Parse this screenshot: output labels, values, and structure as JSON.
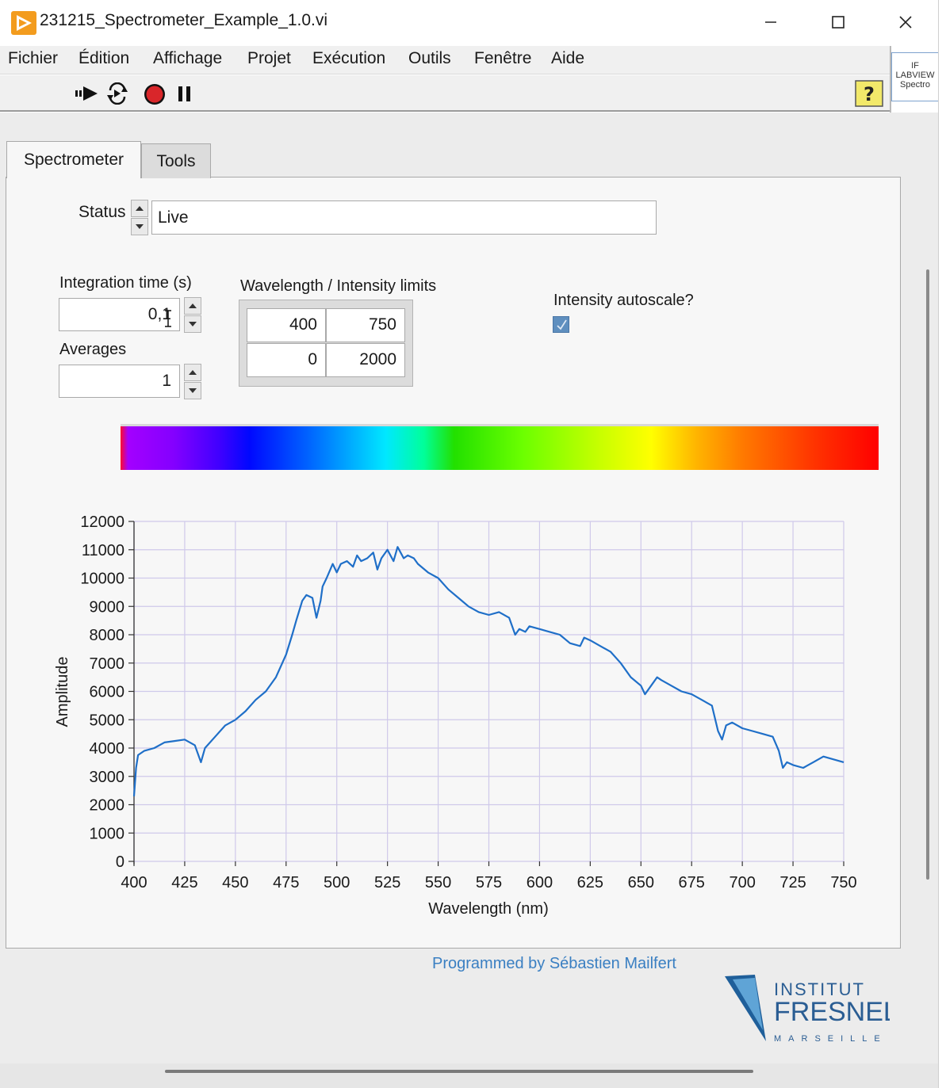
{
  "window": {
    "title": "231215_Spectrometer_Example_1.0.vi",
    "controls": {
      "minimize": "minimize-icon",
      "maximize": "maximize-icon",
      "close": "close-icon"
    }
  },
  "menu": {
    "items": [
      "Fichier",
      "Édition",
      "Affichage",
      "Projet",
      "Exécution",
      "Outils",
      "Fenêtre",
      "Aide"
    ]
  },
  "toolbar": {
    "icons": [
      "run-arrow-icon",
      "run-continuously-icon",
      "abort-stop-icon",
      "pause-icon",
      "context-help-icon"
    ],
    "connector_pane_text": [
      "IF",
      "LABVIEW",
      "Spectro"
    ]
  },
  "tabs": [
    {
      "label": "Spectrometer",
      "active": true
    },
    {
      "label": "Tools",
      "active": false
    }
  ],
  "status": {
    "label": "Status",
    "value": "Live"
  },
  "integration": {
    "label": "Integration time (s)",
    "value": "0,1"
  },
  "averages": {
    "label": "Averages",
    "value": "1"
  },
  "limits": {
    "label": "Wavelength / Intensity limits",
    "wavelength_min": "400",
    "wavelength_max": "750",
    "intensity_min": "0",
    "intensity_max": "2000"
  },
  "autoscale": {
    "label": "Intensity autoscale?",
    "checked": true
  },
  "chart_data": {
    "type": "line",
    "title": "",
    "xlabel": "Wavelength (nm)",
    "ylabel": "Amplitude",
    "xlim": [
      400,
      750
    ],
    "ylim": [
      0,
      12000
    ],
    "x_ticks": [
      400,
      425,
      450,
      475,
      500,
      525,
      550,
      575,
      600,
      625,
      650,
      675,
      700,
      725,
      750
    ],
    "y_ticks": [
      0,
      1000,
      2000,
      3000,
      4000,
      5000,
      6000,
      7000,
      8000,
      9000,
      10000,
      11000,
      12000
    ],
    "grid": true,
    "line_color": "#1f6fc8",
    "series": [
      {
        "x": [
          400,
          401,
          402,
          405,
          410,
          415,
          420,
          425,
          430,
          433,
          435,
          440,
          445,
          450,
          455,
          460,
          465,
          470,
          475,
          478,
          480,
          483,
          485,
          488,
          490,
          492,
          493,
          495,
          498,
          500,
          502,
          505,
          508,
          510,
          512,
          515,
          518,
          520,
          522,
          525,
          528,
          530,
          533,
          535,
          538,
          540,
          545,
          550,
          555,
          560,
          565,
          570,
          575,
          580,
          585,
          588,
          590,
          593,
          595,
          600,
          605,
          610,
          615,
          620,
          622,
          625,
          630,
          635,
          640,
          645,
          650,
          652,
          655,
          658,
          660,
          665,
          670,
          675,
          680,
          685,
          688,
          690,
          692,
          695,
          700,
          705,
          710,
          715,
          718,
          720,
          722,
          725,
          730,
          735,
          740,
          745,
          750
        ],
        "y": [
          2300,
          3300,
          3750,
          3900,
          4000,
          4200,
          4250,
          4300,
          4100,
          3500,
          4000,
          4400,
          4800,
          5000,
          5300,
          5700,
          6000,
          6500,
          7300,
          8000,
          8500,
          9200,
          9400,
          9300,
          8600,
          9200,
          9700,
          10000,
          10500,
          10200,
          10500,
          10600,
          10400,
          10800,
          10600,
          10700,
          10900,
          10300,
          10700,
          11000,
          10600,
          11100,
          10700,
          10800,
          10700,
          10500,
          10200,
          10000,
          9600,
          9300,
          9000,
          8800,
          8700,
          8800,
          8600,
          8000,
          8200,
          8100,
          8300,
          8200,
          8100,
          8000,
          7700,
          7600,
          7900,
          7800,
          7600,
          7400,
          7000,
          6500,
          6200,
          5900,
          6200,
          6500,
          6400,
          6200,
          6000,
          5900,
          5700,
          5500,
          4600,
          4300,
          4800,
          4900,
          4700,
          4600,
          4500,
          4400,
          3900,
          3300,
          3500,
          3400,
          3300,
          3500,
          3700,
          3600,
          3500
        ]
      }
    ]
  },
  "footer": {
    "credit": "Programmed by Sébastien Mailfert",
    "logo_line1": "INSTITUT",
    "logo_line2": "FRESNEL",
    "logo_line3": "MARSEILLE"
  },
  "colors": {
    "accent": "#1f6fc8",
    "grid": "#cfc9ea",
    "credit": "#3a7fc2",
    "logo_blue": "#2a5d93",
    "checkbox": "#5f8fbf"
  }
}
